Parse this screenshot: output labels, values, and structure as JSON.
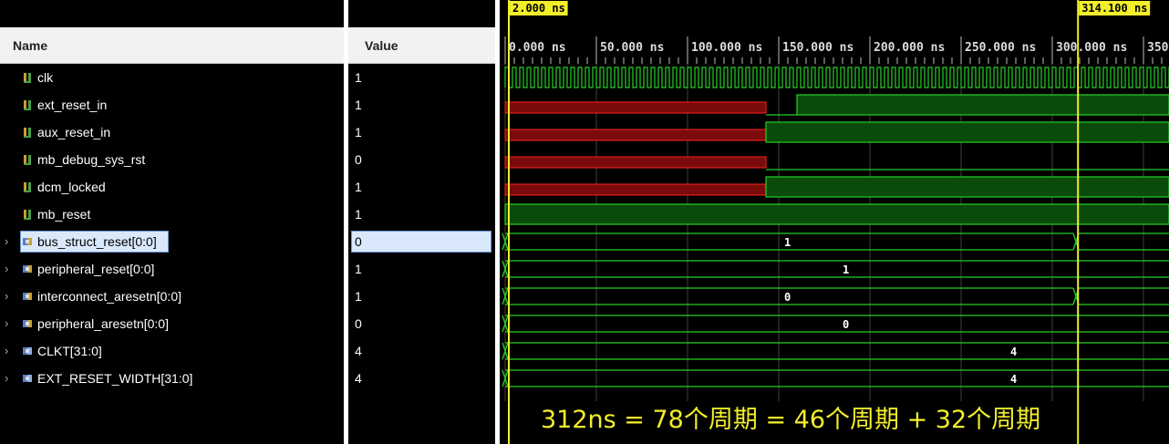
{
  "names_panel": {
    "header": "Name"
  },
  "values_panel": {
    "header": "Value"
  },
  "signals": [
    {
      "name": "clk",
      "value": "1",
      "kind": "bit"
    },
    {
      "name": "ext_reset_in",
      "value": "1",
      "kind": "bit"
    },
    {
      "name": "aux_reset_in",
      "value": "1",
      "kind": "bit"
    },
    {
      "name": "mb_debug_sys_rst",
      "value": "0",
      "kind": "bit"
    },
    {
      "name": "dcm_locked",
      "value": "1",
      "kind": "bit"
    },
    {
      "name": "mb_reset",
      "value": "1",
      "kind": "bit"
    },
    {
      "name": "bus_struct_reset[0:0]",
      "value": "0",
      "kind": "bus",
      "selected": true
    },
    {
      "name": "peripheral_reset[0:0]",
      "value": "1",
      "kind": "bus"
    },
    {
      "name": "interconnect_aresetn[0:0]",
      "value": "1",
      "kind": "bus"
    },
    {
      "name": "peripheral_aresetn[0:0]",
      "value": "0",
      "kind": "bus"
    },
    {
      "name": "CLKT[31:0]",
      "value": "4",
      "kind": "param"
    },
    {
      "name": "EXT_RESET_WIDTH[31:0]",
      "value": "4",
      "kind": "param"
    }
  ],
  "wave": {
    "time_labels": [
      "0.000 ns",
      "50.000 ns",
      "100.000 ns",
      "150.000 ns",
      "200.000 ns",
      "250.000 ns",
      "300.000 ns",
      "350."
    ],
    "markers": [
      {
        "label": "2.000 ns",
        "time_ns": 2
      },
      {
        "label": "314.100 ns",
        "time_ns": 314.1
      }
    ],
    "bus_values": {
      "bus_struct_reset": "1",
      "peripheral_reset": "1",
      "interconnect_aresetn": "0",
      "peripheral_aresetn": "0",
      "CLKT": "4",
      "EXT_RESET_WIDTH": "4"
    },
    "annotation": "312ns = 78个周期 = 46个周期 + 32个周期",
    "colors": {
      "wave": "#24d024",
      "fill_high": "#0a4a0a",
      "fill_x": "#7a0b0b",
      "stroke_x": "#ff2020",
      "marker": "#f2ee2a",
      "grid": "#404040"
    }
  }
}
